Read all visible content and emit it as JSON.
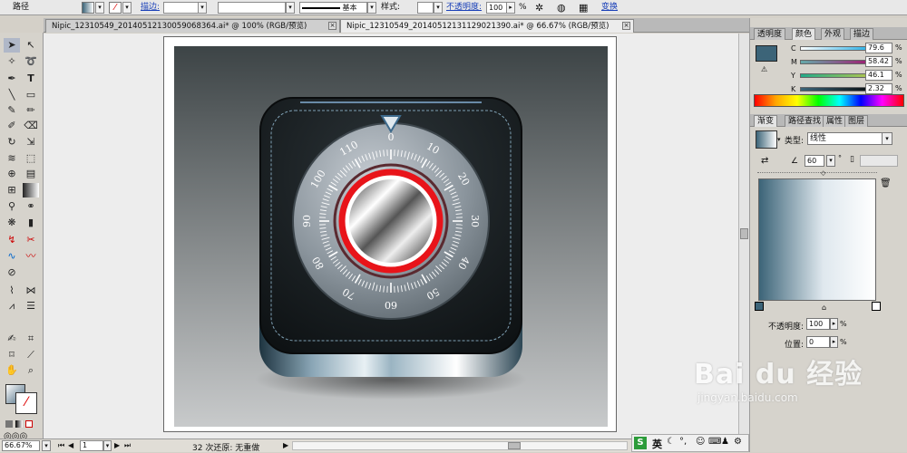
{
  "control_bar": {
    "object_label": "路径",
    "stroke_label": "描边:",
    "stroke_value": "",
    "brush_label": "基本",
    "style_label": "样式:",
    "opacity_label": "不透明度:",
    "opacity_value": "100",
    "opacity_unit": "%",
    "transform_label": "变换"
  },
  "tabs": [
    {
      "label": "Nipic_12310549_20140512130059068364.ai* @ 100% (RGB/预览)"
    },
    {
      "label": "Nipic_12310549_20140512131129021390.ai* @ 66.67% (RGB/预览)"
    }
  ],
  "dial": {
    "numbers": [
      "0",
      "10",
      "20",
      "30",
      "40",
      "50",
      "60",
      "70",
      "80",
      "90",
      "100",
      "110"
    ]
  },
  "color_panel": {
    "tabs": [
      "透明度",
      "颜色",
      "外观",
      "描边"
    ],
    "channels": [
      {
        "name": "C",
        "value": "79.6"
      },
      {
        "name": "M",
        "value": "58.42"
      },
      {
        "name": "Y",
        "value": "46.1"
      },
      {
        "name": "K",
        "value": "2.32"
      }
    ],
    "unit": "%"
  },
  "gradient_panel": {
    "tabs": [
      "渐变",
      "路径查找",
      "属性",
      "图层"
    ],
    "type_label": "类型:",
    "type_value": "线性",
    "angle_value": "60",
    "angle_unit": "°",
    "opacity_label": "不透明度:",
    "opacity_value": "100",
    "location_label": "位置:",
    "location_value": "0",
    "unit": "%"
  },
  "status": {
    "zoom": "66.67%",
    "page": "1",
    "info": "32 次还原: 无重做"
  },
  "ime": {
    "label": "英"
  },
  "watermark": {
    "brand": "Bai du 经验",
    "url": "jingyan.baidu.com"
  },
  "colors": {
    "accent": "#3c6478",
    "ring": "#e8141a"
  }
}
